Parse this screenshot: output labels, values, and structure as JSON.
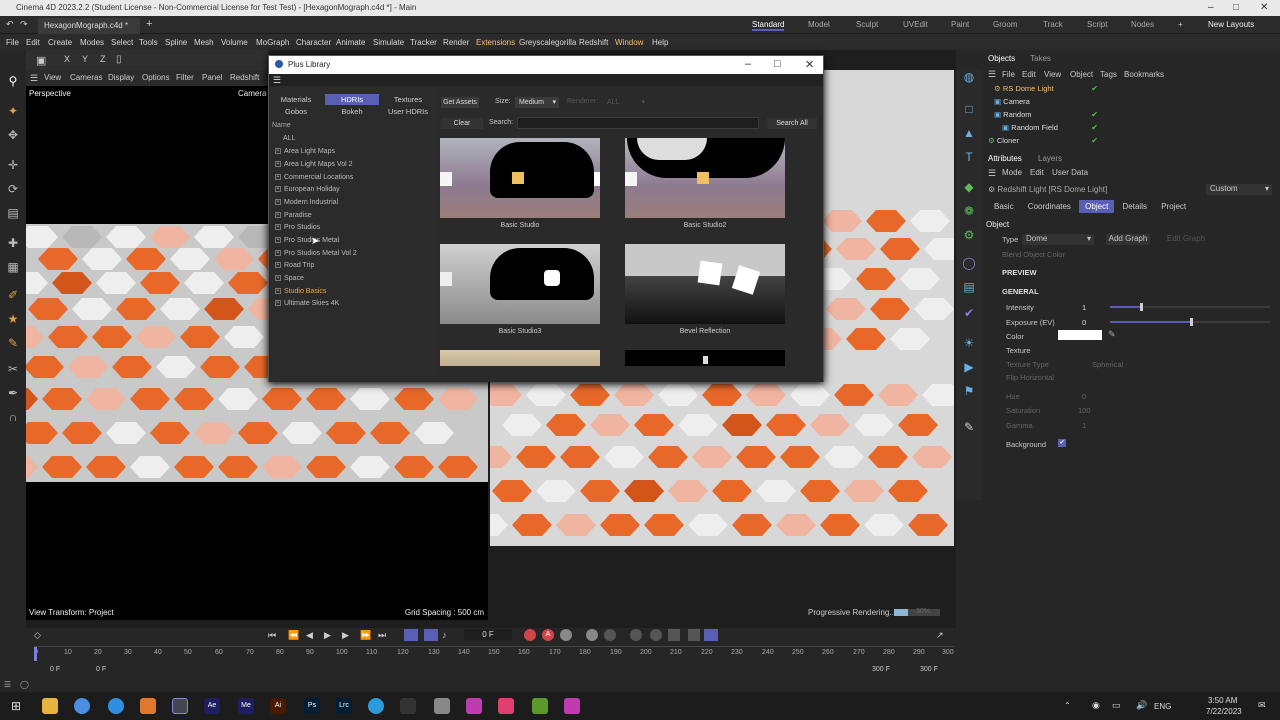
{
  "window_title": "Cinema 4D 2023.2.2 (Student License - Non-Commercial License for Test Test) - [HexagonMograph.c4d *] - Main",
  "doc_tab": "HexagonMograph.c4d *",
  "layouts": [
    "Standard",
    "Model",
    "Sculpt",
    "UVEdit",
    "Paint",
    "Groom",
    "Track",
    "Script",
    "Nodes"
  ],
  "new_layouts": "New Layouts",
  "menu": [
    "File",
    "Edit",
    "Create",
    "Modes",
    "Select",
    "Tools",
    "Spline",
    "Mesh",
    "Volume",
    "MoGraph",
    "Character",
    "Animate",
    "Simulate",
    "Tracker",
    "Render",
    "Extensions",
    "Greyscalegorilla",
    "Redshift",
    "Window",
    "Help"
  ],
  "menu_highlight": "Extensions",
  "viewport_menu": [
    "View",
    "Cameras",
    "Display",
    "Options",
    "Filter",
    "Panel",
    "Redshift"
  ],
  "viewport": {
    "name": "Perspective",
    "camera": "Camera",
    "view_transform": "View Transform: Project",
    "grid_spacing": "Grid Spacing : 500 cm"
  },
  "render_view": {
    "status": "Progressive Rendering...",
    "percent": "30%",
    "progress": 0.3
  },
  "plus_library": {
    "title": "Plus Library",
    "tabs_row1": [
      "Materials",
      "HDRIs",
      "Textures"
    ],
    "tabs_row2": [
      "Gobos",
      "Bokeh",
      "User HDRIs"
    ],
    "active_tab": "HDRIs",
    "name_header": "Name",
    "categories": [
      "ALL",
      "Area Light Maps",
      "Area Light Maps Vol 2",
      "Commercial Locations",
      "European Holiday",
      "Modern Industrial",
      "Paradise",
      "Pro Studios",
      "Pro Studios Metal",
      "Pro Studios Metal Vol 2",
      "Road Trip",
      "Space",
      "Studio Basics",
      "Ultimate Skies 4K"
    ],
    "selected_category": "Studio Basics",
    "get_assets": "Get Assets",
    "size_label": "Size:",
    "size_value": "Medium",
    "renderer_label": "Renderer:",
    "renderer_value": "ALL",
    "clear": "Clear",
    "search_label": "Search:",
    "search_value": "",
    "search_all": "Search All",
    "items": [
      "Basic Studio",
      "Basic Studio2",
      "Basic Studio3",
      "Bevel Reflection"
    ]
  },
  "objects_panel": {
    "tabs": [
      "Objects",
      "Takes"
    ],
    "menu": [
      "File",
      "Edit",
      "View",
      "Object",
      "Tags",
      "Bookmarks"
    ],
    "objects": [
      "RS Dome Light",
      "Camera",
      "Random",
      "Random Field",
      "Cloner"
    ],
    "selected": "RS Dome Light"
  },
  "attributes": {
    "tabs": [
      "Attributes",
      "Layers"
    ],
    "menu": [
      "Mode",
      "Edit",
      "User Data"
    ],
    "title": "Redshift Light [RS Dome Light]",
    "preset": "Custom",
    "subtabs": [
      "Basic",
      "Coordinates",
      "Object",
      "Details",
      "Project"
    ],
    "active_subtab": "Object",
    "section_object": "Object",
    "type_label": "Type",
    "type_value": "Dome",
    "add_graph": "Add Graph",
    "edit_graph": "Edit Graph",
    "blend_object_color": "Blend Object Color",
    "section_preview": "PREVIEW",
    "section_general": "GENERAL",
    "intensity_label": "Intensity",
    "intensity_value": "1",
    "exposure_label": "Exposure (EV)",
    "exposure_value": "0",
    "color_label": "Color",
    "texture_label": "Texture",
    "texture_type_label": "Texture Type",
    "texture_type_value": "Spherical",
    "flip_label": "Flip Horizontal",
    "hue_label": "Hue",
    "hue_value": "0",
    "saturation_label": "Saturation",
    "saturation_value": "100",
    "gamma_label": "Gamma",
    "gamma_value": "1",
    "background_label": "Background"
  },
  "timeline": {
    "frame": "0 F",
    "ticks": [
      "0",
      "10",
      "20",
      "30",
      "40",
      "50",
      "60",
      "70",
      "80",
      "90",
      "100",
      "110",
      "120",
      "130",
      "140",
      "150",
      "160",
      "170",
      "180",
      "190",
      "200",
      "210",
      "220",
      "230",
      "240",
      "250",
      "260",
      "270",
      "280",
      "290",
      "300"
    ],
    "start": "0 F",
    "start2": "0 F",
    "end": "300 F",
    "end2": "300 F"
  },
  "taskbar": {
    "lang": "ENG",
    "time": "3:50 AM",
    "date": "7/22/2023"
  }
}
